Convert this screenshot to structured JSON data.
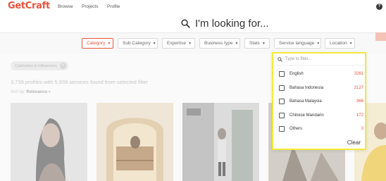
{
  "nav": {
    "logo": "GetCraft",
    "links": [
      "Browse",
      "Projects",
      "Profile"
    ],
    "help_icon": "?"
  },
  "search": {
    "placeholder": "I'm looking for..."
  },
  "filters": [
    {
      "label": "Category",
      "active": true
    },
    {
      "label": "Sub Category",
      "active": false
    },
    {
      "label": "Expertise",
      "active": false
    },
    {
      "label": "Business type",
      "active": false
    },
    {
      "label": "Stats",
      "active": false
    },
    {
      "label": "Service language",
      "active": false
    },
    {
      "label": "Location",
      "active": false
    }
  ],
  "content": {
    "selected_tag": "Celebrities & Influencers",
    "results_count": "3,739 profiles with 5,959 services found from selected filter",
    "sort_label": "Sort by:",
    "sort_value": "Relevance"
  },
  "dropdown": {
    "filter_placeholder": "Type to filter...",
    "options": [
      {
        "label": "English",
        "count": "3261",
        "checked": false
      },
      {
        "label": "Bahasa Indonesia",
        "count": "2127",
        "checked": false
      },
      {
        "label": "Bahasa Malaysia",
        "count": "366",
        "checked": false
      },
      {
        "label": "Chinese Mandarin",
        "count": "172",
        "checked": false
      },
      {
        "label": "Others",
        "count": "3",
        "checked": false
      }
    ],
    "clear_label": "Clear"
  },
  "colors": {
    "brand": "#e8533d",
    "highlight": "#f3ea3c"
  }
}
